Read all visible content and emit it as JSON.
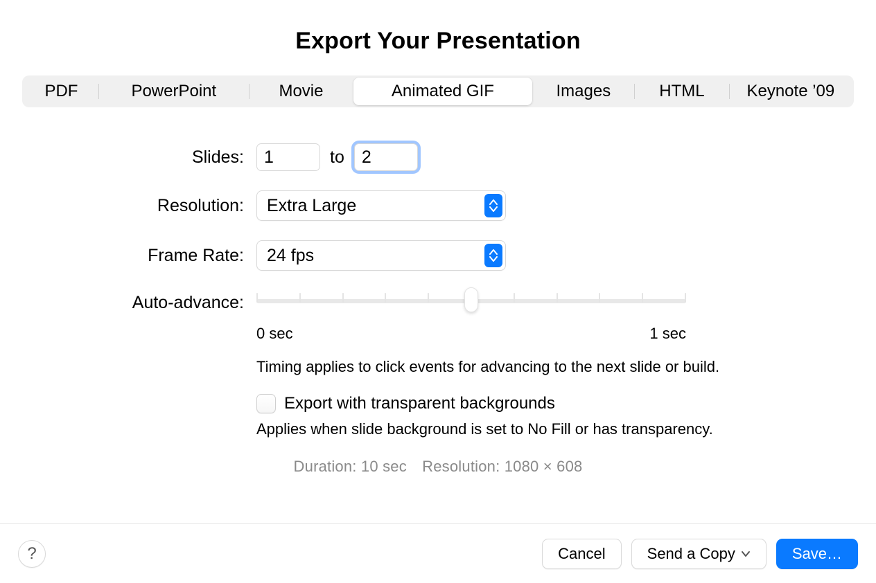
{
  "title": "Export Your Presentation",
  "tabs": [
    "PDF",
    "PowerPoint",
    "Movie",
    "Animated GIF",
    "Images",
    "HTML",
    "Keynote ’09"
  ],
  "tabWidths": [
    108,
    218,
    151,
    260,
    148,
    137,
    178
  ],
  "activeTab": 3,
  "slides": {
    "label": "Slides:",
    "from": "1",
    "to": "2",
    "toWord": "to"
  },
  "resolution": {
    "label": "Resolution:",
    "value": "Extra Large"
  },
  "frameRate": {
    "label": "Frame Rate:",
    "value": "24 fps"
  },
  "autoAdvance": {
    "label": "Auto-advance:",
    "min": "0 sec",
    "max": "1 sec",
    "help": "Timing applies to click events for advancing to the next slide or build."
  },
  "transparent": {
    "label": "Export with transparent backgrounds",
    "hint": "Applies when slide background is set to No Fill or has transparency.",
    "checked": false
  },
  "summary": "Duration: 10 sec Resolution: 1080 × 608",
  "footer": {
    "cancel": "Cancel",
    "sendCopy": "Send a Copy",
    "save": "Save…"
  }
}
